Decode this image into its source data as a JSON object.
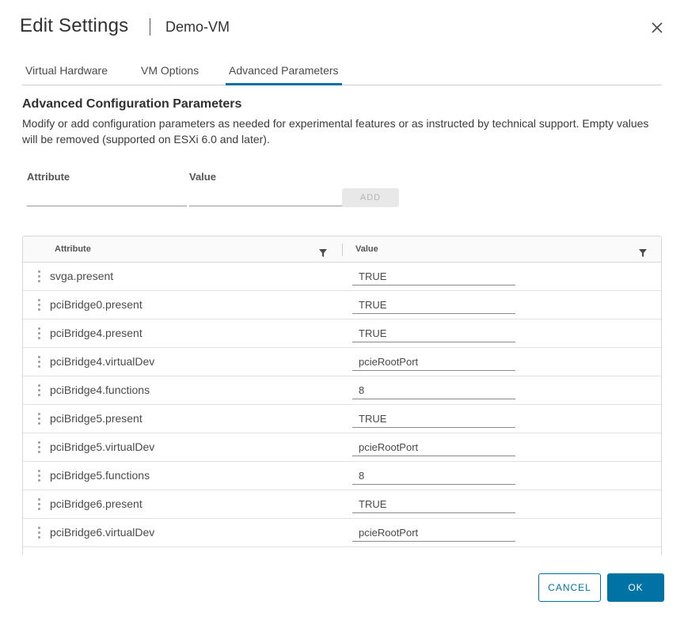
{
  "dialog": {
    "title": "Edit Settings",
    "vm_name": "Demo-VM",
    "close_icon": "close-icon"
  },
  "tabs": [
    {
      "label": "Virtual Hardware",
      "active": false
    },
    {
      "label": "VM Options",
      "active": false
    },
    {
      "label": "Advanced Parameters",
      "active": true
    }
  ],
  "section": {
    "title": "Advanced Configuration Parameters",
    "description": "Modify or add configuration parameters as needed for experimental features or as instructed by technical support. Empty values will be removed (supported on ESXi 6.0 and later)."
  },
  "add_form": {
    "attribute_label": "Attribute",
    "value_label": "Value",
    "attribute_value": "",
    "value_value": "",
    "add_button": "ADD"
  },
  "grid": {
    "columns": [
      "Attribute",
      "Value"
    ],
    "filter_icon": "filter-icon",
    "rows": [
      {
        "attribute": "svga.present",
        "value": "TRUE"
      },
      {
        "attribute": "pciBridge0.present",
        "value": "TRUE"
      },
      {
        "attribute": "pciBridge4.present",
        "value": "TRUE"
      },
      {
        "attribute": "pciBridge4.virtualDev",
        "value": "pcieRootPort"
      },
      {
        "attribute": "pciBridge4.functions",
        "value": "8"
      },
      {
        "attribute": "pciBridge5.present",
        "value": "TRUE"
      },
      {
        "attribute": "pciBridge5.virtualDev",
        "value": "pcieRootPort"
      },
      {
        "attribute": "pciBridge5.functions",
        "value": "8"
      },
      {
        "attribute": "pciBridge6.present",
        "value": "TRUE"
      },
      {
        "attribute": "pciBridge6.virtualDev",
        "value": "pcieRootPort"
      }
    ]
  },
  "footer": {
    "cancel_label": "CANCEL",
    "ok_label": "OK"
  },
  "colors": {
    "accent": "#0072a3",
    "disabled_button_bg": "#e8e8e8",
    "border": "#d7d7d7"
  }
}
